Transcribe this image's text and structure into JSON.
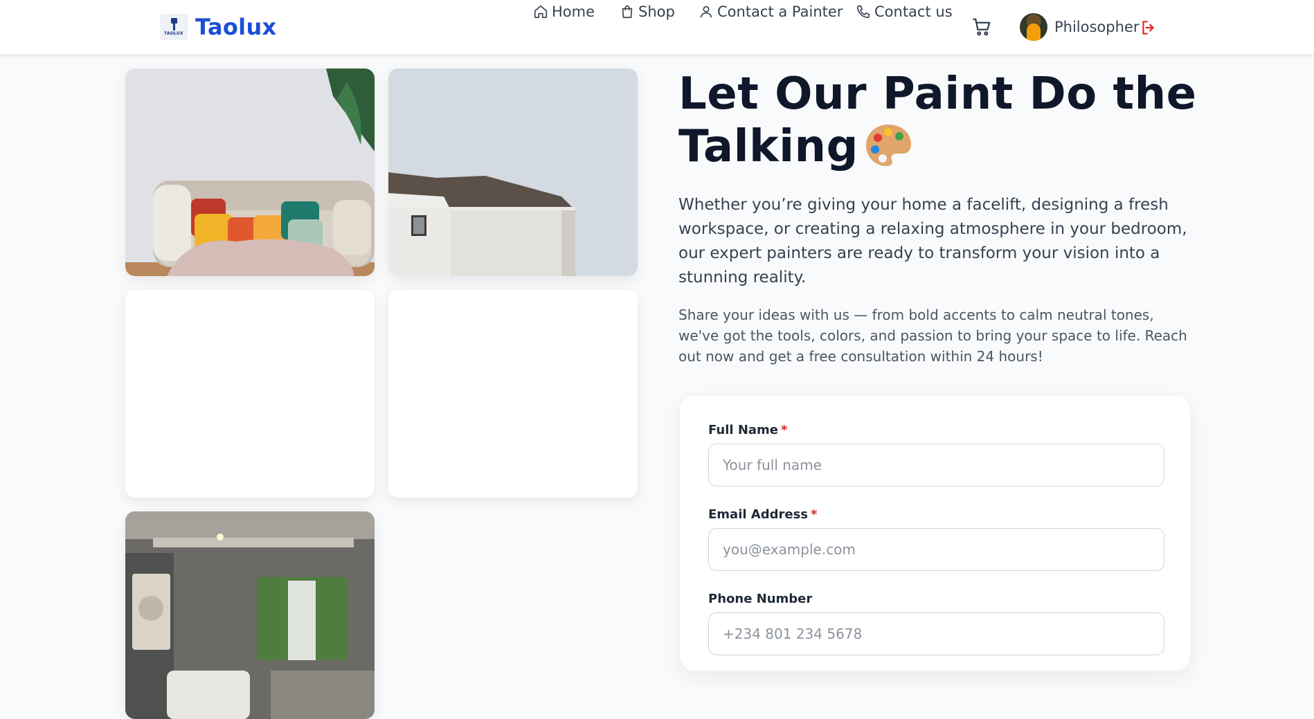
{
  "header": {
    "brand": {
      "logo_text": "TAOLUX",
      "name": "Taolux"
    },
    "nav": [
      {
        "label": "Home",
        "icon": "home-icon"
      },
      {
        "label": "Shop",
        "icon": "shopping-bag-icon"
      },
      {
        "label": "Contact a Painter",
        "icon": "user-icon"
      },
      {
        "label": "Contact us",
        "icon": "phone-icon"
      }
    ],
    "cart_icon": "cart-icon",
    "user": {
      "name": "Philosopher",
      "logout_icon": "logout-icon"
    }
  },
  "gallery": {
    "tiles": [
      "living-room-sofa",
      "house-roof",
      "blank",
      "blank",
      "bathroom-interior"
    ]
  },
  "hero": {
    "title": "Let Our Paint Do the Talking",
    "title_emoji": "palette-icon",
    "lead": "Whether you’re giving your home a facelift, designing a fresh workspace, or creating a relaxing atmosphere in your bedroom, our expert painters are ready to transform your vision into a stunning reality.",
    "sub": "Share your ideas with us — from bold accents to calm neutral tones, we've got the tools, colors, and passion to bring your space to life. Reach out now and get a free consultation within 24 hours!"
  },
  "form": {
    "full_name": {
      "label": "Full Name",
      "required_mark": "*",
      "placeholder": "Your full name",
      "value": ""
    },
    "email": {
      "label": "Email Address",
      "required_mark": "*",
      "placeholder": "you@example.com",
      "value": ""
    },
    "phone": {
      "label": "Phone Number",
      "placeholder": "+234 801 234 5678",
      "value": ""
    }
  },
  "colors": {
    "brand": "#1d4ed8",
    "heading": "#0f172a",
    "required": "#dc2626",
    "logout": "#dc2626"
  }
}
